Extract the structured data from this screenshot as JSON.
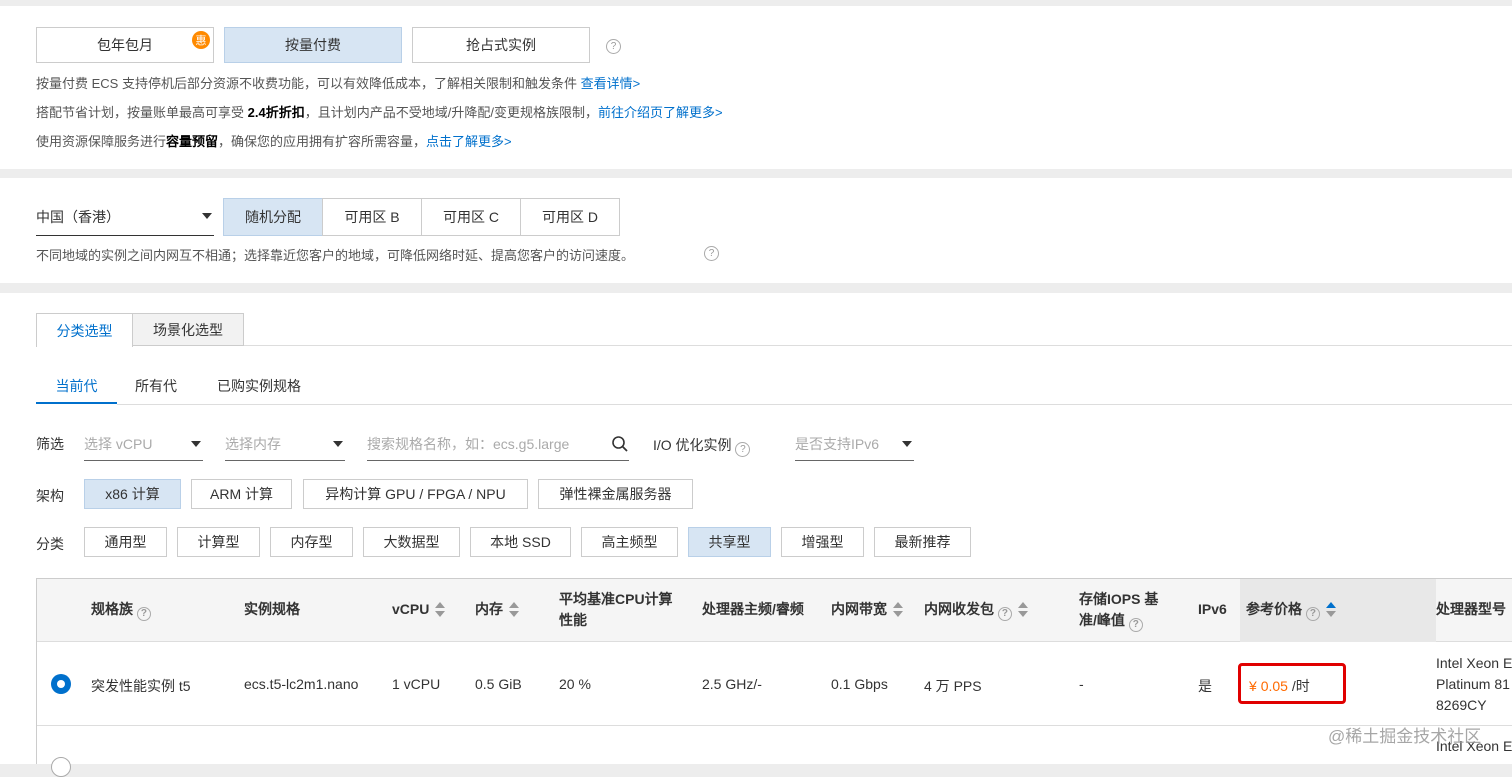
{
  "billing": {
    "options": [
      {
        "label": "包年包月",
        "badge": "惠"
      },
      {
        "label": "按量付费"
      },
      {
        "label": "抢占式实例"
      }
    ],
    "selected": "按量付费",
    "notes": {
      "line1_text": "按量付费 ECS 支持停机后部分资源不收费功能，可以有效降低成本，了解相关限制和触发条件",
      "line1_link": "查看详情>",
      "line2_pre": "搭配节省计划，按量账单最高可享受",
      "line2_bold": "2.4折折扣",
      "line2_post": "，且计划内产品不受地域/升降配/变更规格族限制，",
      "line2_link": "前往介绍页了解更多>",
      "line3_pre": "使用资源保障服务进行",
      "line3_bold": "容量预留",
      "line3_post": "，确保您的应用拥有扩容所需容量，",
      "line3_link": "点击了解更多>"
    }
  },
  "region": {
    "selected": "中国（香港）",
    "zones": [
      "随机分配",
      "可用区 B",
      "可用区 C",
      "可用区 D"
    ],
    "selected_zone": "随机分配",
    "note": "不同地域的实例之间内网互不相通；选择靠近您客户的地域，可降低网络时延、提高您客户的访问速度。"
  },
  "selection_tabs": [
    "分类选型",
    "场景化选型"
  ],
  "generation_tabs": [
    "当前代",
    "所有代",
    "已购实例规格"
  ],
  "filters": {
    "label": "筛选",
    "vcpu_placeholder": "选择 vCPU",
    "memory_placeholder": "选择内存",
    "search_placeholder": "搜索规格名称，如：ecs.g5.large",
    "io_label": "I/O 优化实例",
    "ipv6_placeholder": "是否支持IPv6"
  },
  "architecture": {
    "label": "架构",
    "options": [
      "x86 计算",
      "ARM 计算",
      "异构计算 GPU / FPGA / NPU",
      "弹性裸金属服务器"
    ],
    "selected": "x86 计算"
  },
  "category": {
    "label": "分类",
    "options": [
      "通用型",
      "计算型",
      "内存型",
      "大数据型",
      "本地 SSD",
      "高主频型",
      "共享型",
      "增强型",
      "最新推荐"
    ],
    "selected": "共享型"
  },
  "table": {
    "headers": {
      "family": "规格族",
      "spec": "实例规格",
      "vcpu": "vCPU",
      "memory": "内存",
      "cpu_perf": "平均基准CPU计算性能",
      "freq": "处理器主频/睿频",
      "bandwidth": "内网带宽",
      "pps": "内网收发包",
      "iops": "存储IOPS 基准/峰值",
      "ipv6": "IPv6",
      "price": "参考价格",
      "cpu_model": "处理器型号"
    },
    "rows": [
      {
        "family": "突发性能实例 t5",
        "spec": "ecs.t5-lc2m1.nano",
        "vcpu": "1 vCPU",
        "memory": "0.5 GiB",
        "cpu_perf": "20 %",
        "freq": "2.5 GHz/-",
        "bandwidth": "0.1 Gbps",
        "pps": "4 万 PPS",
        "iops": "-",
        "ipv6": "是",
        "price_currency": "¥",
        "price_value": "0.05",
        "price_unit": "/时",
        "cpu_model_l1": "Intel Xeon E",
        "cpu_model_l2": "Platinum 81",
        "cpu_model_l3": "8269CY"
      },
      {
        "cpu_model_l1": "Intel Xeon E"
      }
    ]
  },
  "watermark": "@稀土掘金技术社区",
  "colors": {
    "accent": "#0070cc",
    "selected_bg": "#d7e5f3",
    "price": "#ff6a00",
    "highlight_border": "#e00000"
  }
}
